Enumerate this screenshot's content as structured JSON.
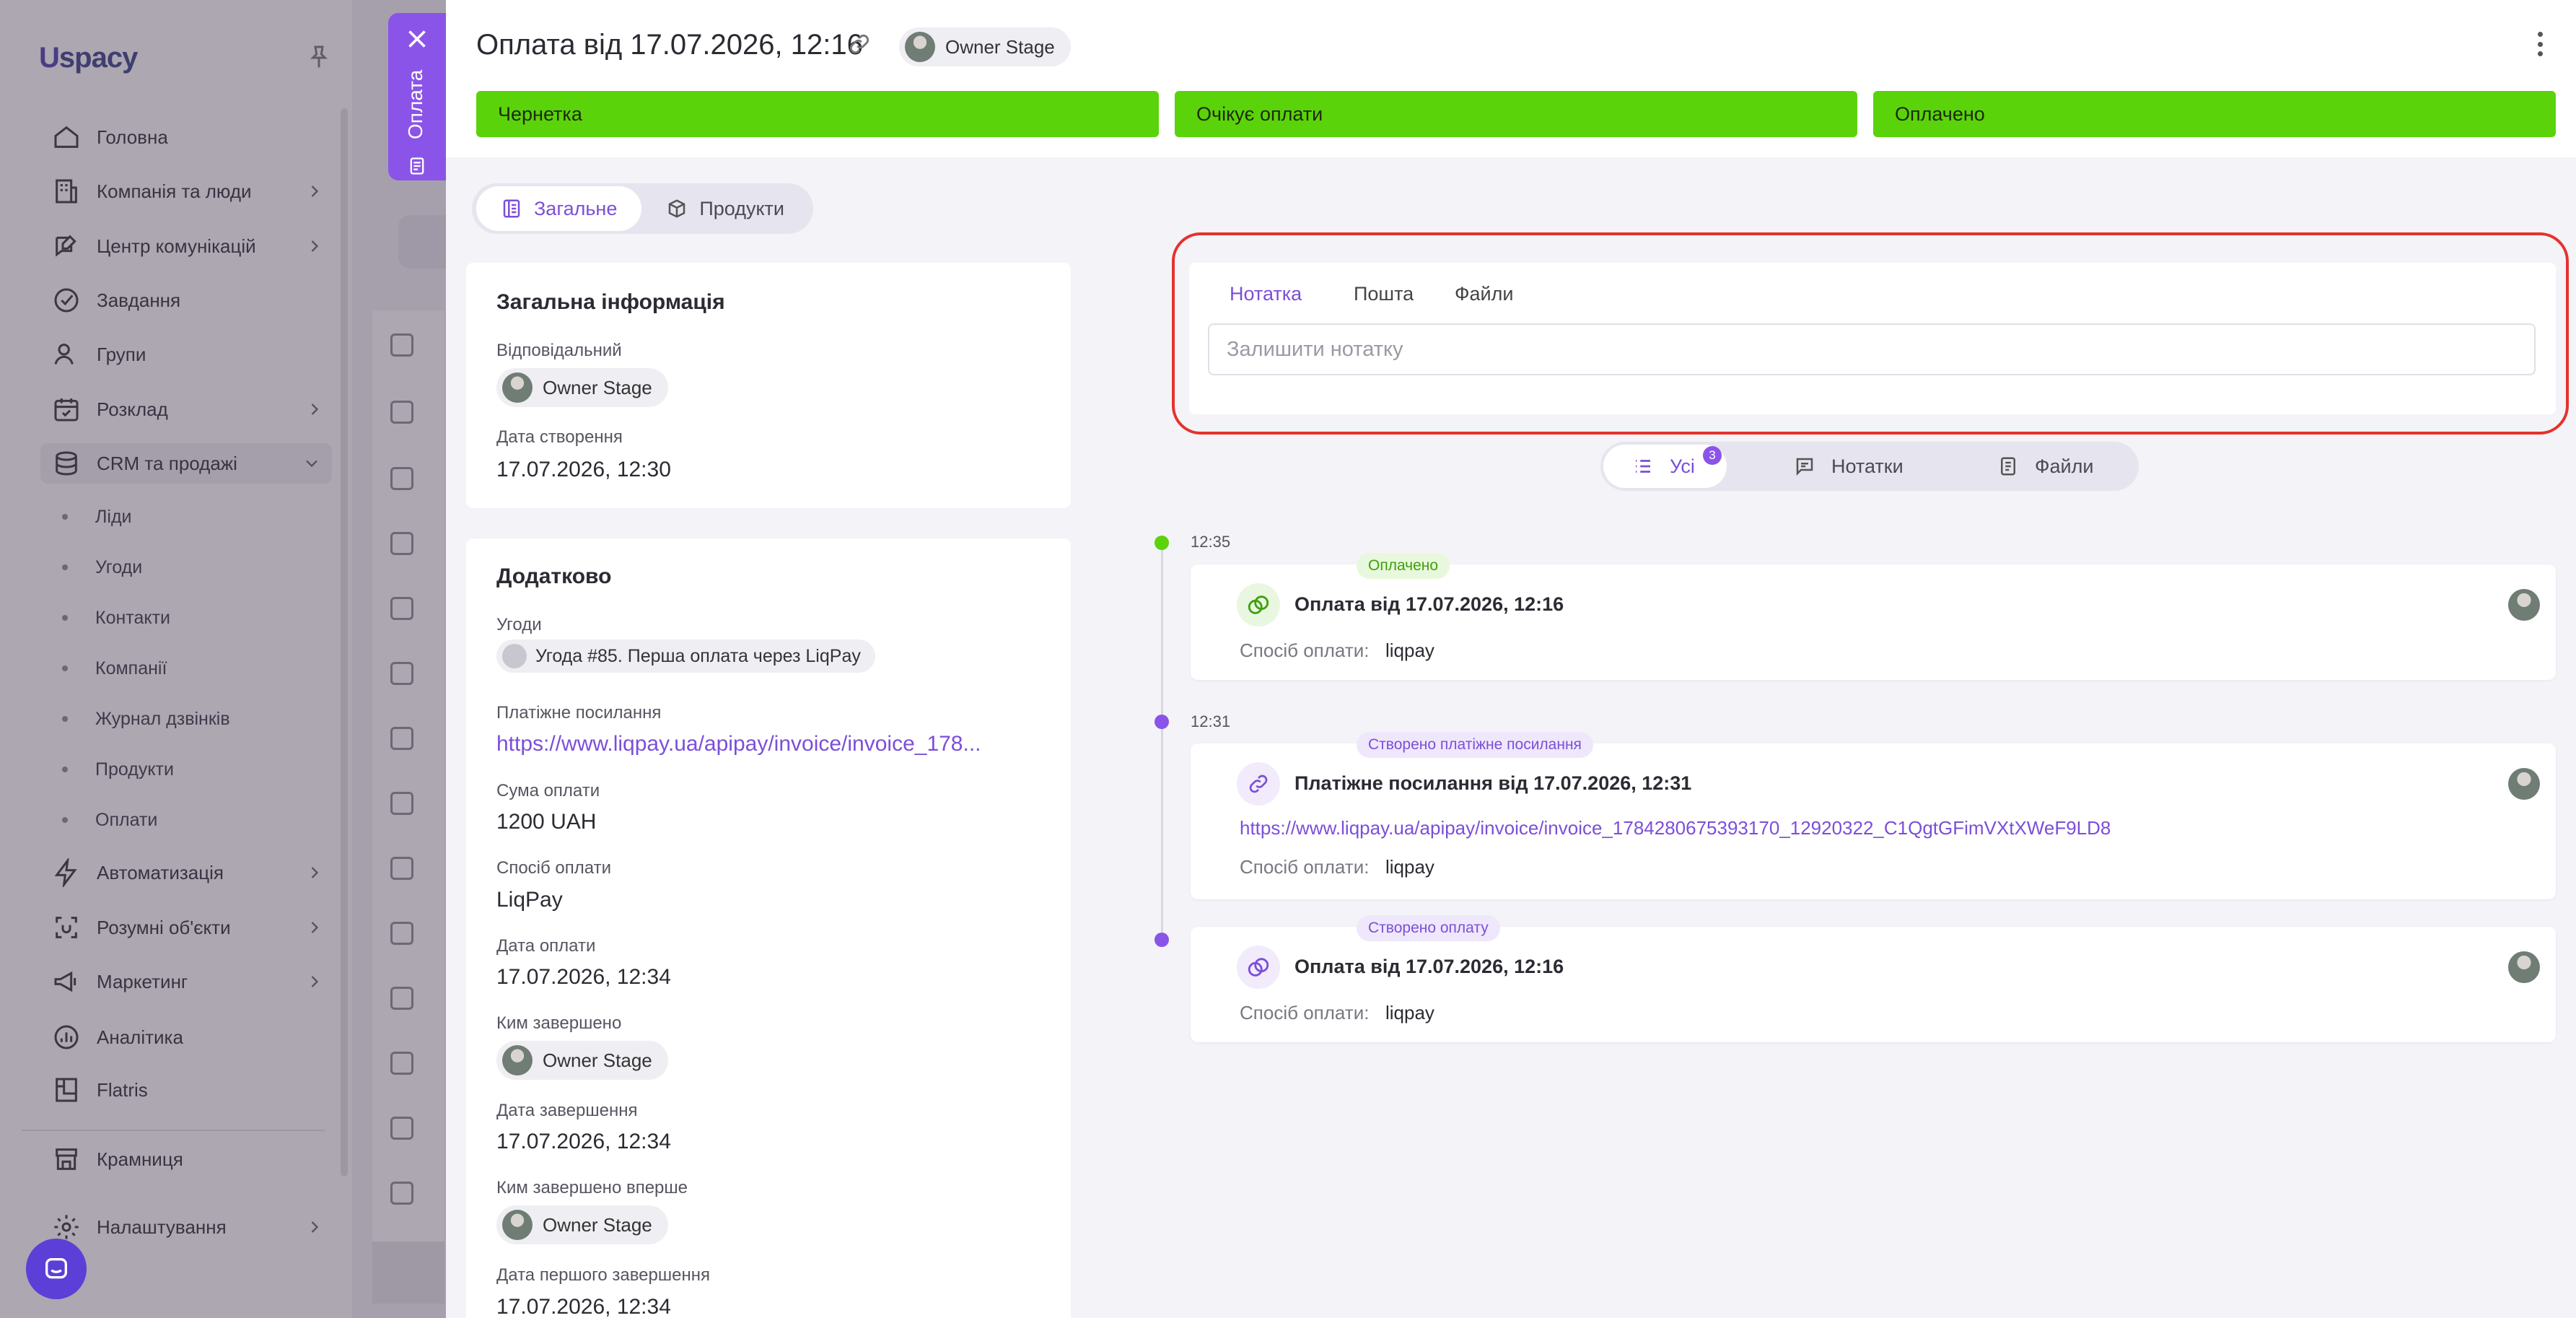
{
  "sidebar": {
    "logo": "Uspacy",
    "items": [
      {
        "label": "Головна",
        "icon": "home-icon"
      },
      {
        "label": "Компанія та люди",
        "icon": "company-icon"
      },
      {
        "label": "Центр комунікацій",
        "icon": "chat-edit-icon"
      },
      {
        "label": "Завдання",
        "icon": "check-circle-icon"
      },
      {
        "label": "Групи",
        "icon": "users-icon"
      },
      {
        "label": "Розклад",
        "icon": "calendar-icon"
      },
      {
        "label": "CRM та продажі",
        "icon": "database-icon"
      }
    ],
    "crm_sub": [
      "Ліди",
      "Угоди",
      "Контакти",
      "Компанії",
      "Журнал дзвінків",
      "Продукти",
      "Оплати"
    ],
    "items_bottom": [
      {
        "label": "Автоматизація",
        "icon": "bolt-icon"
      },
      {
        "label": "Розумні об'єкти",
        "icon": "smart-object-icon"
      },
      {
        "label": "Маркетинг",
        "icon": "megaphone-icon"
      },
      {
        "label": "Аналітика",
        "icon": "chart-icon"
      },
      {
        "label": "Flatris",
        "icon": "flatris-icon"
      },
      {
        "label": "Крамниця",
        "icon": "store-icon"
      },
      {
        "label": "Налаштування",
        "icon": "settings-icon"
      }
    ]
  },
  "side_tab": {
    "label": "Оплата"
  },
  "header": {
    "title": "Оплата від 17.07.2026, 12:16",
    "owner": "Owner Stage",
    "stages": [
      "Чернетка",
      "Очікує оплати",
      "Оплачено"
    ],
    "stage_color": "#5bd30a"
  },
  "tabs": [
    "Загальне",
    "Продукти"
  ],
  "general_info": {
    "title": "Загальна інформація",
    "responsible_label": "Відповідальний",
    "responsible": "Owner Stage",
    "created_label": "Дата створення",
    "created": "17.07.2026, 12:30"
  },
  "additional": {
    "title": "Додатково",
    "deals_label": "Угоди",
    "deal": "Угода #85. Перша оплата через LiqPay",
    "payment_link_label": "Платіжне посилання",
    "payment_link": "https://www.liqpay.ua/apipay/invoice/invoice_178...",
    "amount_label": "Сума оплати",
    "amount": "1200 UAH",
    "method_label": "Спосіб оплати",
    "method": "LiqPay",
    "pay_date_label": "Дата оплати",
    "pay_date": "17.07.2026, 12:34",
    "completed_by_label": "Ким завершено",
    "completed_by": "Owner Stage",
    "completed_date_label": "Дата завершення",
    "completed_date": "17.07.2026, 12:34",
    "first_completed_by_label": "Ким завершено вперше",
    "first_completed_by": "Owner Stage",
    "first_completed_date_label": "Дата першого завершення",
    "first_completed_date": "17.07.2026, 12:34"
  },
  "composer": {
    "tabs": [
      "Нотатка",
      "Пошта",
      "Файли"
    ],
    "placeholder": "Залишити нотатку"
  },
  "filter": {
    "tabs": [
      "Усі",
      "Нотатки",
      "Файли"
    ],
    "all_count": "3"
  },
  "timeline": [
    {
      "time": "12:35",
      "tag": "Оплачено",
      "title": "Оплата від 17.07.2026, 12:16",
      "method_label": "Спосіб оплати:",
      "method": "liqpay"
    },
    {
      "time": "12:31",
      "tag": "Створено платіжне посилання",
      "title": "Платіжне посилання від 17.07.2026, 12:31",
      "link": "https://www.liqpay.ua/apipay/invoice/invoice_1784280675393170_12920322_C1QgtGFimVXtXWeF9LD8",
      "method_label": "Спосіб оплати:",
      "method": "liqpay"
    },
    {
      "time": "",
      "tag": "Створено оплату",
      "title": "Оплата від 17.07.2026, 12:16",
      "method_label": "Спосіб оплати:",
      "method": "liqpay"
    }
  ],
  "colors": {
    "accent": "#8b54e8",
    "stage": "#5bd30a",
    "highlight": "#e5322d",
    "paid_dot": "#5bd30a"
  }
}
